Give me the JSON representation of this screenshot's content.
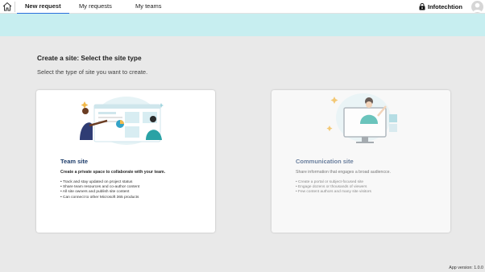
{
  "nav": {
    "tabs": [
      {
        "label": "New request",
        "active": true
      },
      {
        "label": "My requests",
        "active": false
      },
      {
        "label": "My teams",
        "active": false
      }
    ],
    "brand": "Infotechtion",
    "home_icon": "home-icon",
    "avatar_icon": "user-avatar-icon"
  },
  "colors": {
    "accent": "#2a6fdb",
    "band": "#c7eef0",
    "background": "#e9e9e9",
    "card_title": "#1e3d6b"
  },
  "page": {
    "title": "Create a site: Select the site type",
    "subtitle": "Select the type of site you want to create."
  },
  "cards": [
    {
      "title": "Team site",
      "description": "Create a private space to collaborate with your team.",
      "bullets": [
        "Track and stay updated on project status",
        "Share team resources and co-author content",
        "All site owners and publish site content",
        "Can connect to other Microsoft 365 products"
      ]
    },
    {
      "title": "Communication site",
      "description": "Share information that engages a broad audiencce.",
      "bullets": [
        "Create a portal or subject-focused site",
        "Engage dozens or thousands of viewers",
        "Few content authors and many site visitors"
      ]
    }
  ],
  "footer": {
    "app_version": "App version: 1.0.0"
  }
}
